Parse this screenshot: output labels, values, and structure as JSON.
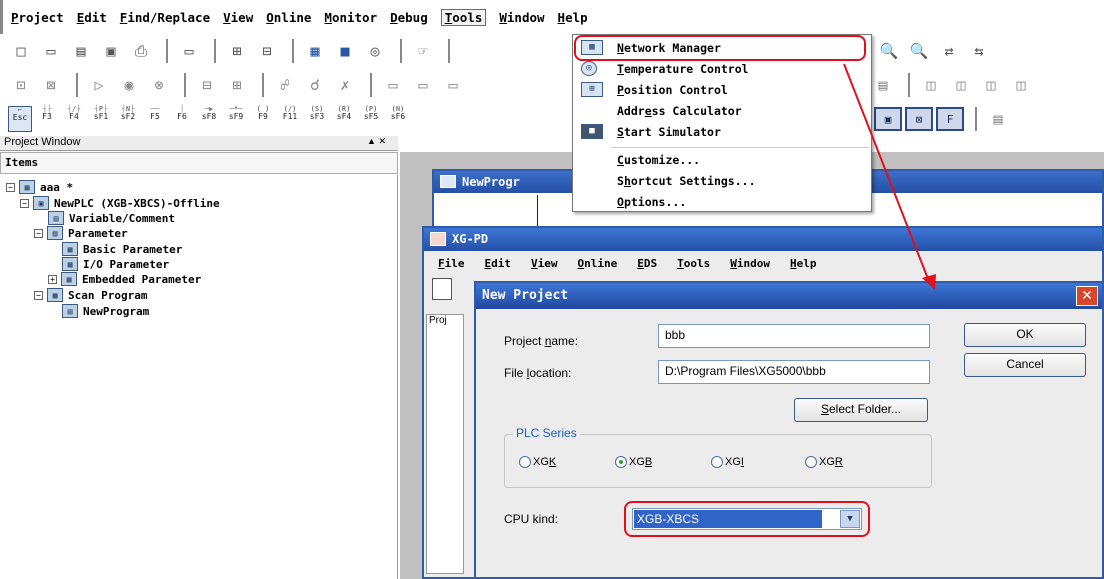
{
  "menubar": {
    "items": [
      {
        "key": "P",
        "rest": "roject"
      },
      {
        "key": "E",
        "rest": "dit"
      },
      {
        "key": "F",
        "rest": "ind/Replace"
      },
      {
        "key": "V",
        "rest": "iew"
      },
      {
        "key": "O",
        "rest": "nline"
      },
      {
        "key": "M",
        "rest": "onitor"
      },
      {
        "key": "D",
        "rest": "ebug"
      },
      {
        "key": "T",
        "rest": "ools"
      },
      {
        "key": "W",
        "rest": "indow"
      },
      {
        "key": "H",
        "rest": "elp"
      }
    ]
  },
  "fkeys": {
    "esc": "Esc",
    "f3": "F3",
    "f4": "F4",
    "sf1": "sF1",
    "sf2": "sF2",
    "f5": "F5",
    "f6": "F6",
    "sf8": "sF8",
    "sf9": "sF9",
    "f9": "F9",
    "f11": "F11",
    "sf3": "sF3",
    "sf4": "sF4",
    "sf5": "sF5",
    "sf6": "sF6"
  },
  "tools_menu": {
    "items": [
      {
        "key": "N",
        "rest": "etwork Manager"
      },
      {
        "key": "T",
        "rest": "emperature Control"
      },
      {
        "key": "P",
        "rest": "osition Control"
      },
      {
        "pre": "Addr",
        "key": "e",
        "rest": "ss Calculator"
      },
      {
        "key": "S",
        "rest": "tart Simulator"
      },
      {
        "key": "C",
        "rest": "ustomize..."
      },
      {
        "pre": "S",
        "key": "h",
        "rest": "ortcut Settings..."
      },
      {
        "key": "O",
        "rest": "ptions..."
      }
    ]
  },
  "project_window": {
    "title": "Project Window",
    "header": "Items",
    "tree": {
      "root": "aaa *",
      "plc": "NewPLC (XGB-XBCS)-Offline",
      "variable": "Variable/Comment",
      "parameter": "Parameter",
      "basic": "Basic Parameter",
      "io": "I/O Parameter",
      "embedded": "Embedded Parameter",
      "scan": "Scan Program",
      "newprogram": "NewProgram"
    }
  },
  "np_window": {
    "title": "NewProgr"
  },
  "xg_window": {
    "title": "XG-PD",
    "menu": [
      {
        "key": "F",
        "rest": "ile"
      },
      {
        "key": "E",
        "rest": "dit"
      },
      {
        "key": "V",
        "rest": "iew"
      },
      {
        "key": "O",
        "rest": "nline"
      },
      {
        "key": "E",
        "rest": "DS"
      },
      {
        "key": "T",
        "rest": "ools"
      },
      {
        "key": "W",
        "rest": "indow"
      },
      {
        "key": "H",
        "rest": "elp"
      }
    ],
    "proj_tab": "Proj"
  },
  "dialog": {
    "title": "New Project",
    "close_glyph": "✕",
    "name_label": {
      "pre": "Project ",
      "key": "n",
      "rest": "ame:"
    },
    "name_value": "bbb",
    "location_label": {
      "pre": "File ",
      "key": "l",
      "rest": "ocation:"
    },
    "location_value": "D:\\Program Files\\XG5000\\bbb",
    "ok": "OK",
    "cancel": "Cancel",
    "select_folder": {
      "key": "S",
      "rest": "elect Folder..."
    },
    "plc_series": {
      "legend": "PLC Series",
      "options": [
        {
          "pre": "XG",
          "key": "K",
          "selected": false
        },
        {
          "pre": "XG",
          "key": "B",
          "selected": true
        },
        {
          "pre": "XG",
          "key": "I",
          "selected": false
        },
        {
          "pre": "XG",
          "key": "R",
          "selected": false
        }
      ]
    },
    "cpu_label": "CPU kind:",
    "cpu_value": "XGB-XBCS"
  },
  "colors": {
    "highlight": "#e0101c",
    "title_bar": "#2450a6",
    "selected_radio": "#2f9e3a"
  }
}
